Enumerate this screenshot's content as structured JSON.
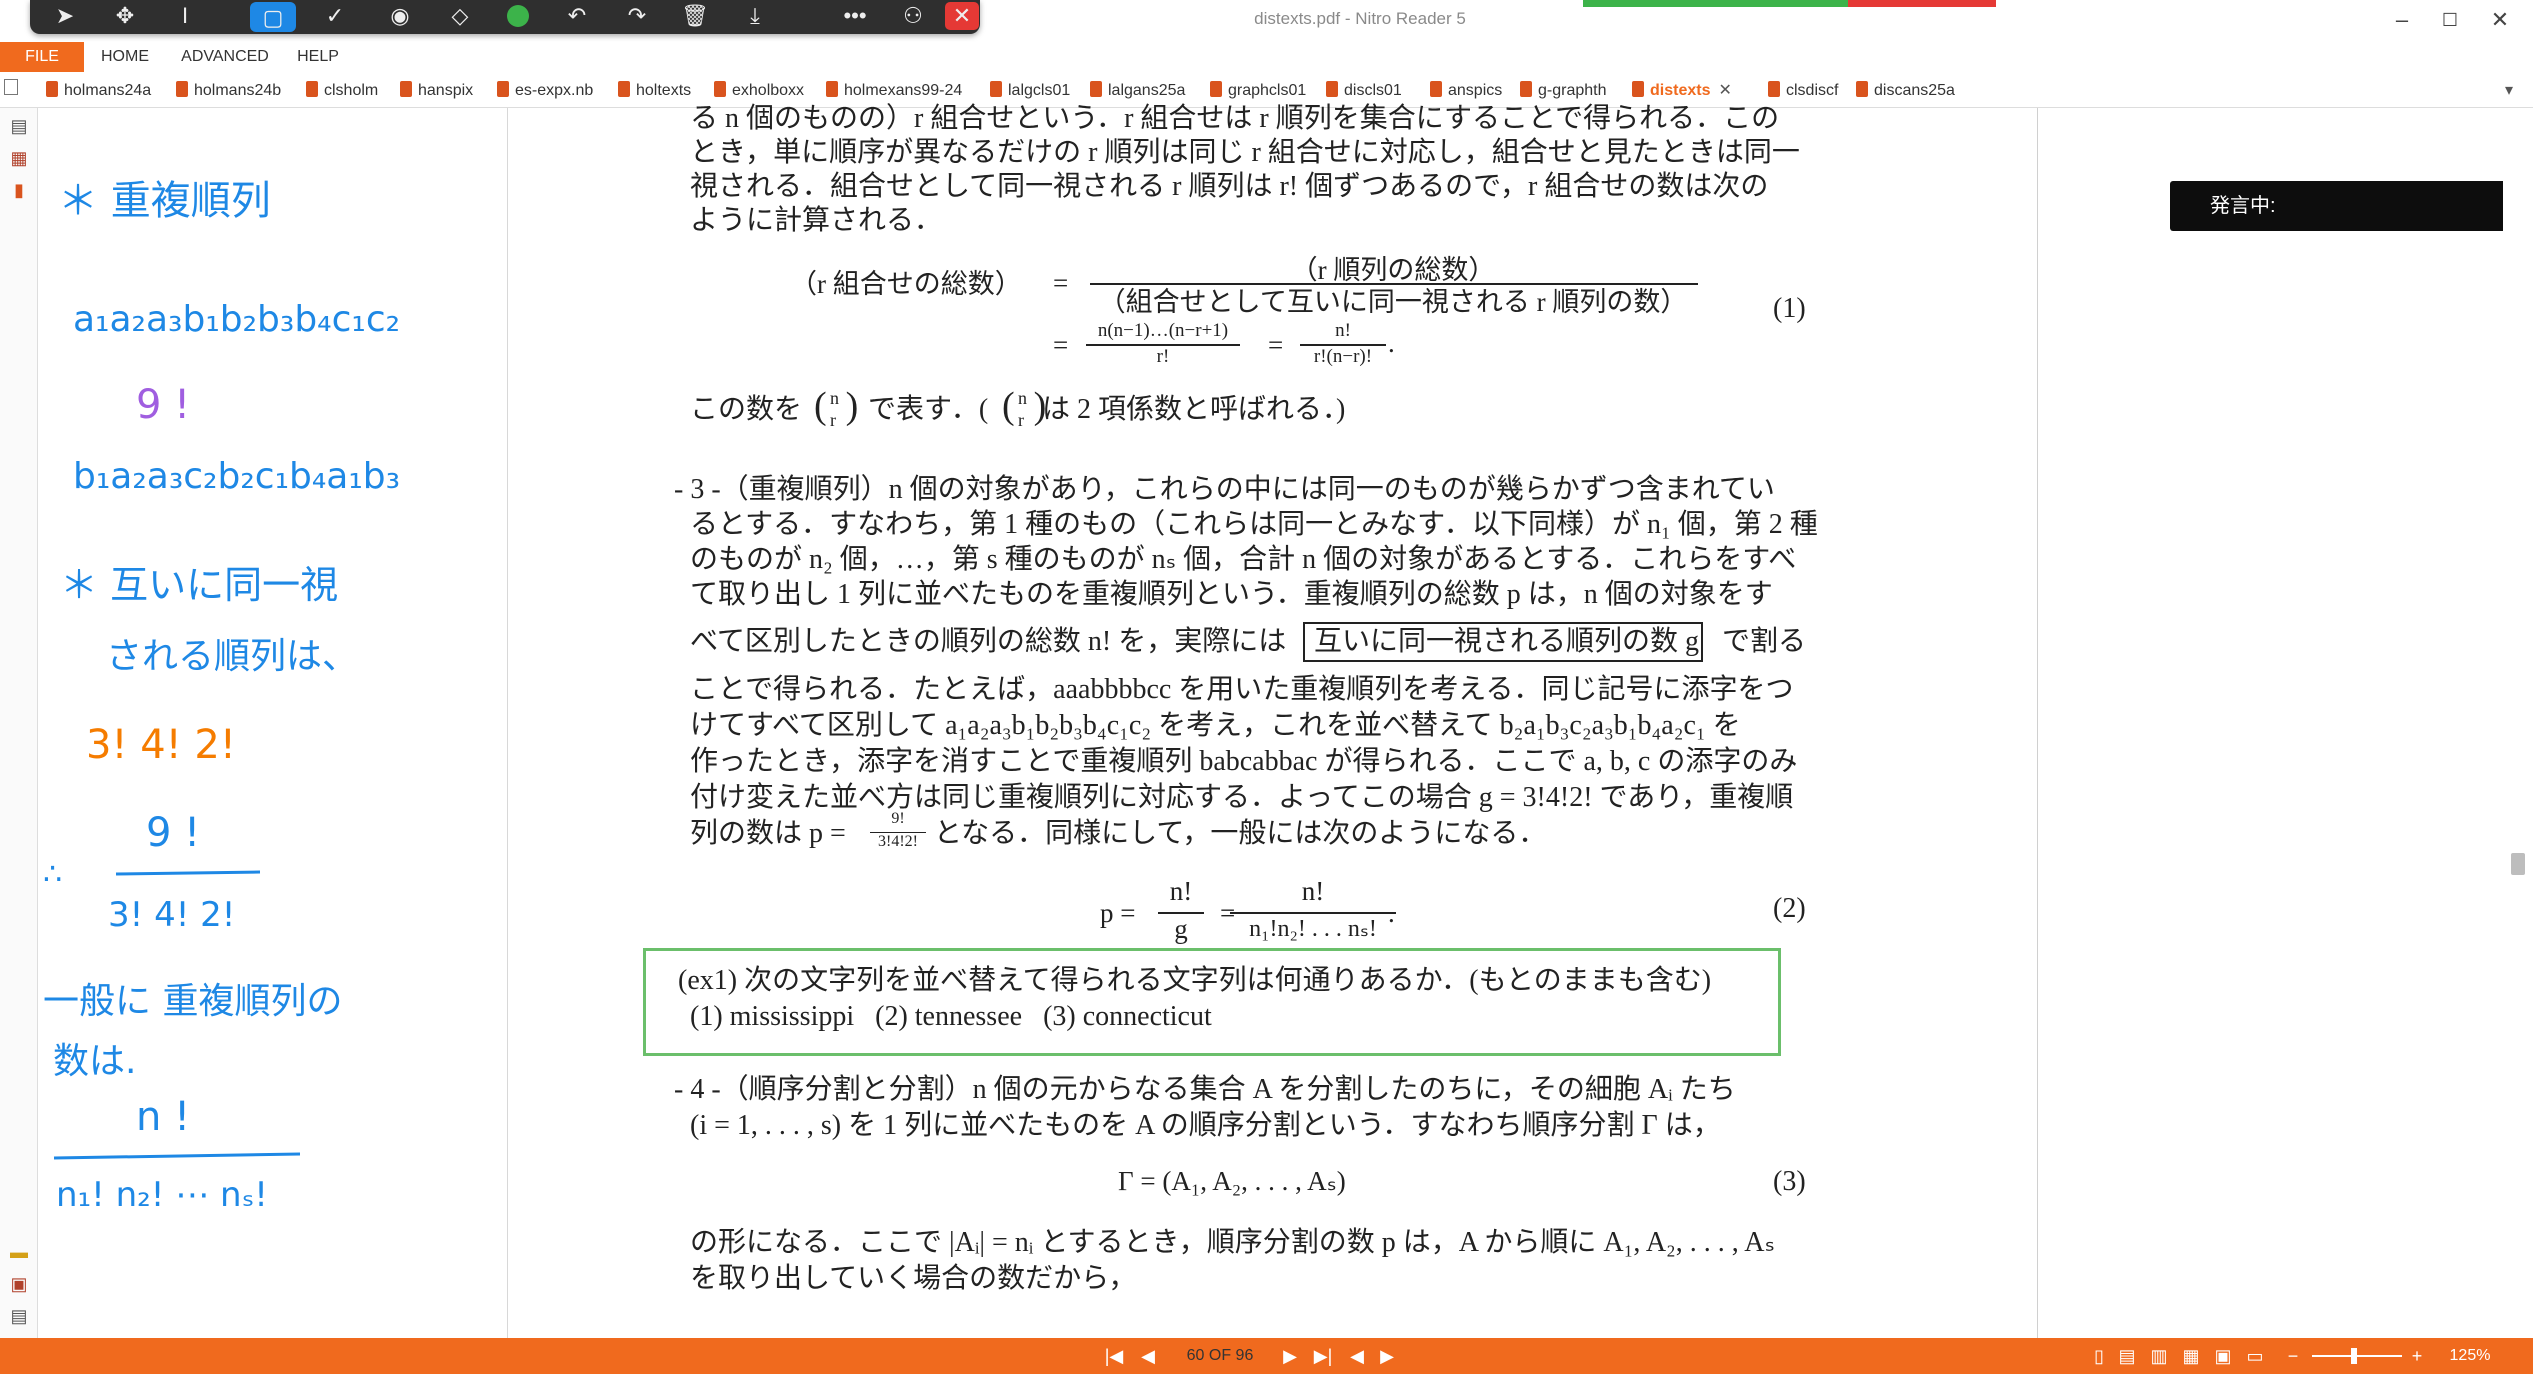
{
  "window": {
    "title": "distexts.pdf - Nitro Reader 5",
    "minimize_glyph": "–",
    "maximize_glyph": "☐",
    "close_glyph": "✕"
  },
  "ink_toolbar": {
    "icons": [
      "select-arrow-icon",
      "move-icon",
      "text-cursor-icon",
      "rectangle-icon",
      "checkmark-icon",
      "ink-pen-icon",
      "eraser-icon",
      "color-swatch-icon",
      "undo-icon",
      "redo-icon",
      "delete-icon",
      "download-icon",
      "more-icon",
      "presenter-icon",
      "close-icon"
    ],
    "swatch_color": "#3cb34a",
    "active_color": "#1e88e5",
    "close_color": "#e53935"
  },
  "menubar": {
    "file": "FILE",
    "home": "HOME",
    "advanced": "ADVANCED",
    "help": "HELP"
  },
  "tabs": [
    {
      "label": "holmans24a"
    },
    {
      "label": "holmans24b"
    },
    {
      "label": "clsholm"
    },
    {
      "label": "hanspix"
    },
    {
      "label": "es-expx.nb"
    },
    {
      "label": "holtexts"
    },
    {
      "label": "exholboxx"
    },
    {
      "label": "holmexans99-24"
    },
    {
      "label": "lalgcls01"
    },
    {
      "label": "lalgans25a"
    },
    {
      "label": "graphcls01"
    },
    {
      "label": "discls01"
    },
    {
      "label": "anspics"
    },
    {
      "label": "g-graphth"
    },
    {
      "label": "distexts",
      "active": true
    },
    {
      "label": "clsdiscf"
    },
    {
      "label": "discans25a"
    }
  ],
  "tab_close_glyph": "✕",
  "tab_overflow_glyph": "▾",
  "notes": {
    "lines": [
      {
        "text": "＊ 重複順列",
        "color": "#1e88e5"
      },
      {
        "text": "a₁a₂a₃b₁b₂b₃b₄c₁c₂",
        "color": "#1e88e5"
      },
      {
        "text": "9 !",
        "color": "#a05ee0"
      },
      {
        "text": "b₁a₂a₃c₂b₂c₁b₄a₁b₃",
        "color": "#1e88e5"
      },
      {
        "text": "＊ 互いに同一視",
        "color": "#1e88e5"
      },
      {
        "text": "される順列は、",
        "color": "#1e88e5"
      },
      {
        "text": "3! 4! 2!",
        "color": "#f57c00"
      },
      {
        "text": "9 !",
        "color": "#1e88e5"
      },
      {
        "text": "∴",
        "color": "#1e88e5"
      },
      {
        "text": "3! 4! 2!",
        "color": "#1e88e5"
      },
      {
        "text": "一般に 重複順列の",
        "color": "#1e88e5"
      },
      {
        "text": "数は.",
        "color": "#1e88e5"
      },
      {
        "text": "n !",
        "color": "#1e88e5"
      },
      {
        "text": "n₁! n₂! ⋯ nₛ!",
        "color": "#1e88e5"
      }
    ]
  },
  "caption_box": {
    "text": "発言中:"
  },
  "document": {
    "lines": [
      "る n 個のものの）r 組合せという．r 組合せは r 順列を集合にすることで得られる．この",
      "とき，単に順序が異なるだけの r 順列は同じ r 組合せに対応し，組合せと見たときは同一",
      "視される．組合せとして同一視される r 順列は r! 個ずつあるので，r 組合せの数は次の",
      "ように計算される．"
    ],
    "eq1": {
      "lhs": "（r 組合せの総数）",
      "eq": "=",
      "num": "（r 順列の総数）",
      "den": "（組合せとして互いに同一視される r 順列の数）",
      "line2_eq": "=",
      "line2_num": "n(n−1)…(n−r+1)",
      "line2_den": "r!",
      "line2_eq2": "=",
      "line2_num2": "n!",
      "line2_den2": "r!(n−r)!",
      "line2_dot": ".",
      "number": "(1)"
    },
    "binom_line": {
      "pre": "この数を",
      "mid": "で表す．(",
      "post": "は 2 項係数と呼ばれる．)",
      "top": "n",
      "bottom": "r"
    },
    "sec3": [
      "- 3 -（重複順列）n 個の対象があり，これらの中には同一のものが幾らかずつ含まれてい",
      "るとする．すなわち，第 1 種のもの（これらは同一とみなす．以下同様）が n₁ 個，第 2 種",
      "のものが n₂ 個，…，第 s 種のものが nₛ 個，合計 n 個の対象があるとする．これらをすべ",
      "て取り出し 1 列に並べたものを重複順列という．重複順列の総数 p は，n 個の対象をす"
    ],
    "sec3_box_pre": "べて区別したときの順列の総数 n! を，実際には",
    "sec3_box_text": "互いに同一視される順列の数 g",
    "sec3_box_post": "で割る",
    "sec3b": [
      "ことで得られる．たとえば，aaabbbbcc を用いた重複順列を考える．同じ記号に添字をつ",
      "けてすべて区別して a₁a₂a₃b₁b₂b₃b₄c₁c₂ を考え，これを並べ替えて b₂a₁b₃c₂a₃b₁b₄a₂c₁ を",
      "作ったとき，添字を消すことで重複順列 babcabbac が得られる．ここで a, b, c の添字のみ",
      "付け変えた並べ方は同じ重複順列に対応する．よってこの場合 g = 3!4!2! であり，重複順"
    ],
    "sec3c_pre": "列の数は p =",
    "sec3c_num": "9!",
    "sec3c_den": "3!4!2!",
    "sec3c_post": "となる．同様にして，一般には次のようになる．",
    "eq2": {
      "lhs": "p =",
      "num1": "n!",
      "den1": "g",
      "eq": "=",
      "num2": "n!",
      "den2": "n₁!n₂! . . . nₛ!",
      "dot": ".",
      "number": "(2)"
    },
    "ex1": {
      "line1": "(ex1) 次の文字列を並べ替えて得られる文字列は何通りあるか．(もとのままも含む)",
      "line2": "(1) mississippi   (2) tennessee   (3) connecticut"
    },
    "sec4": [
      "- 4 -（順序分割と分割）n 個の元からなる集合 A を分割したのちに，その細胞 Aᵢ たち",
      "(i = 1, . . . , s) を 1 列に並べたものを A の順序分割という．すなわち順序分割 Γ は，"
    ],
    "eq3": {
      "text": "Γ = (A₁, A₂, . . . , Aₛ)",
      "number": "(3)"
    },
    "sec4b": [
      "の形になる．ここで |Aᵢ| = nᵢ とするとき，順序分割の数 p は，A から順に A₁, A₂, . . . , Aₛ",
      "を取り出していく場合の数だから，"
    ]
  },
  "statusbar": {
    "page_indicator": "60 OF 96",
    "first_glyph": "|◀",
    "prev_glyph": "◀",
    "next_glyph": "▶",
    "last_glyph": "▶|",
    "back_glyph": "◀",
    "forward_glyph": "▶",
    "zoom_minus": "−",
    "zoom_plus": "+",
    "zoom_level": "125%",
    "view_icons": [
      "single-page-icon",
      "continuous-icon",
      "facing-icon",
      "facing-continuous-icon",
      "fit-page-icon",
      "fit-width-icon"
    ]
  }
}
